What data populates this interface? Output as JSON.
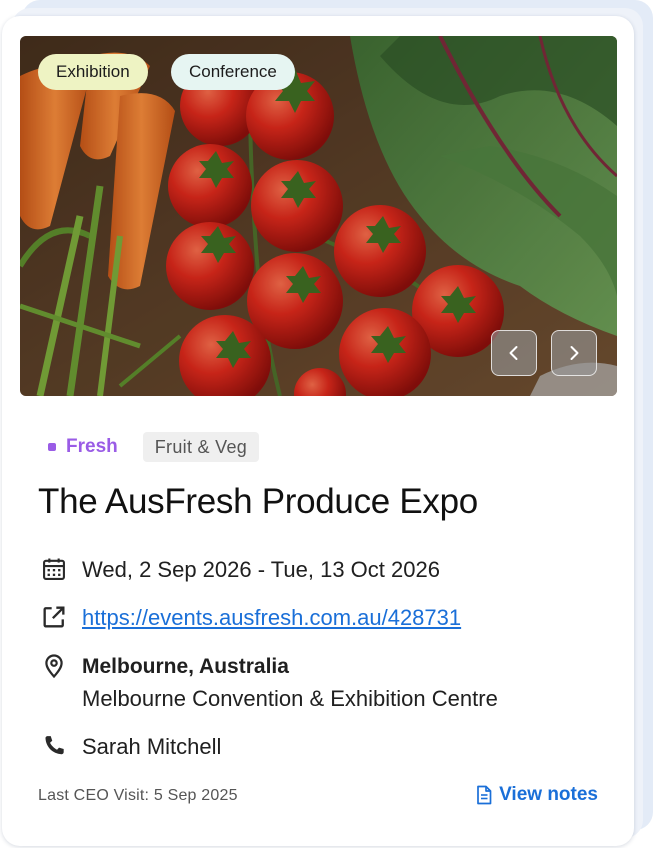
{
  "event": {
    "tags": [
      "Exhibition",
      "Conference"
    ],
    "industry": "Fresh",
    "category": "Fruit & Veg",
    "title": "The AusFresh Produce Expo",
    "dates": "Wed, 2 Sep 2026 - Tue, 13 Oct 2026",
    "url": "https://events.ausfresh.com.au/428731",
    "location_city": "Melbourne, Australia",
    "venue": "Melbourne Convention & Exhibition Centre",
    "contact": "Sarah Mitchell",
    "last_visit": "Last CEO Visit: 5 Sep 2025",
    "view_notes_label": "View notes"
  },
  "icons": {
    "calendar": "calendar-icon",
    "link": "external-link-icon",
    "location": "map-pin-icon",
    "phone": "phone-icon",
    "notes": "document-icon",
    "prev": "chevron-left-icon",
    "next": "chevron-right-icon"
  },
  "colors": {
    "accent_purple": "#9a5ce6",
    "link_blue": "#1a6fd8",
    "exhibition_chip": "#eef3c3",
    "conference_chip": "#e6f5f2"
  }
}
